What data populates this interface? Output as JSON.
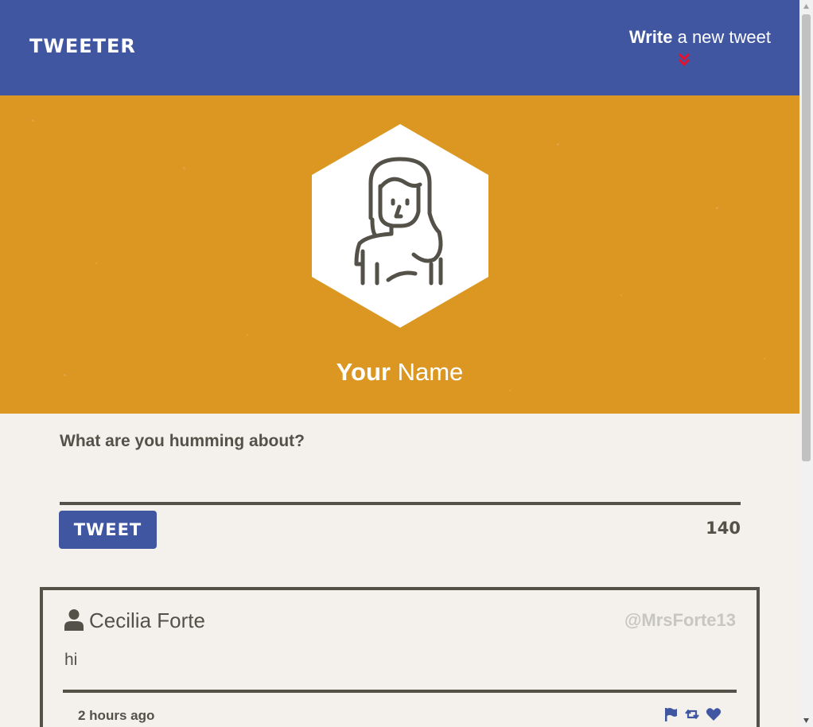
{
  "nav": {
    "brand": "TWEETER",
    "compose_strong": "Write",
    "compose_rest": "a new tweet",
    "compose_icon": "double-chevron-down-icon"
  },
  "profile": {
    "name_strong": "Your",
    "name_rest": "Name",
    "avatar_icon": "woman-avatar-icon"
  },
  "compose": {
    "prompt": "What are you humming about?",
    "input_value": "",
    "button_label": "TWEET",
    "counter": "140"
  },
  "tweet": {
    "name": "Cecilia Forte",
    "handle": "@MrsForte13",
    "body": "hi",
    "time": "2 hours ago",
    "actions": [
      "flag-icon",
      "retweet-icon",
      "heart-icon"
    ]
  },
  "colors": {
    "nav_bg": "#4056a1",
    "header_bg": "#db9722",
    "page_bg": "#f4f1ec",
    "text": "#545149",
    "accent_red": "#e8112d"
  }
}
